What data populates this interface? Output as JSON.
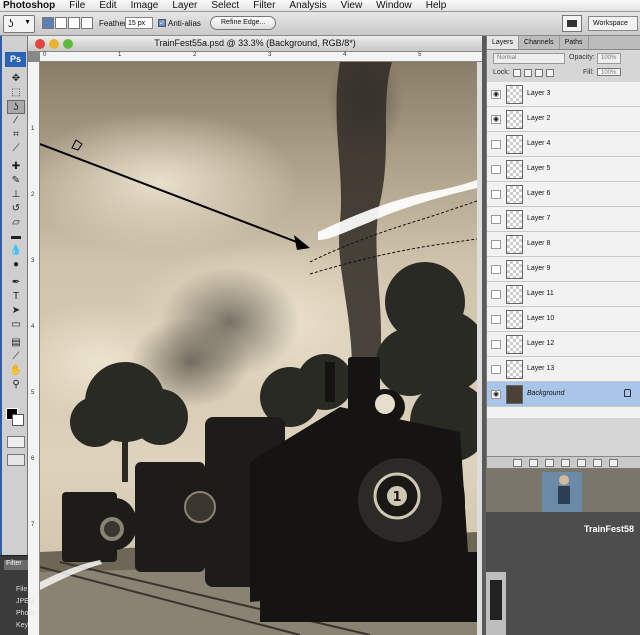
{
  "menubar": {
    "app": "Photoshop",
    "items": [
      "File",
      "Edit",
      "Image",
      "Layer",
      "Select",
      "Filter",
      "Analysis",
      "View",
      "Window",
      "Help"
    ]
  },
  "options": {
    "feather_label": "Feather:",
    "feather_value": "15 px",
    "antialias_label": "Anti-alias",
    "refine_edge": "Refine Edge...",
    "workspace": "Workspace"
  },
  "document": {
    "title": "TrainFest55a.psd @ 33.3% (Background, RGB/8*)",
    "ruler_top_ticks": [
      "0",
      "1",
      "2",
      "3",
      "4",
      "5"
    ],
    "ruler_left_ticks": [
      "1",
      "2",
      "3",
      "4",
      "5",
      "6",
      "7"
    ]
  },
  "toolbox": {
    "logo": "Ps"
  },
  "panels": {
    "tabs": [
      "Layers",
      "Channels",
      "Paths"
    ],
    "blend_mode": "Normal",
    "opacity_label": "Opacity:",
    "opacity_value": "100%",
    "lock_label": "Lock:",
    "fill_label": "Fill:",
    "fill_value": "100%",
    "layers": [
      {
        "name": "Layer 3",
        "visible": true
      },
      {
        "name": "Layer 2",
        "visible": true
      },
      {
        "name": "Layer 4",
        "visible": false
      },
      {
        "name": "Layer 5",
        "visible": false
      },
      {
        "name": "Layer 6",
        "visible": false
      },
      {
        "name": "Layer 7",
        "visible": false
      },
      {
        "name": "Layer 8",
        "visible": false
      },
      {
        "name": "Layer 9",
        "visible": false
      },
      {
        "name": "Layer 11",
        "visible": false
      },
      {
        "name": "Layer 10",
        "visible": false
      },
      {
        "name": "Layer 12",
        "visible": false
      },
      {
        "name": "Layer 13",
        "visible": false
      },
      {
        "name": "Background",
        "visible": true,
        "active": true,
        "locked": true
      }
    ]
  },
  "dock": {
    "filename": "TrainFest58"
  },
  "leftpalette": {
    "header": "Filter",
    "items": [
      "File",
      "JPEG",
      "Photo",
      "Key"
    ]
  }
}
